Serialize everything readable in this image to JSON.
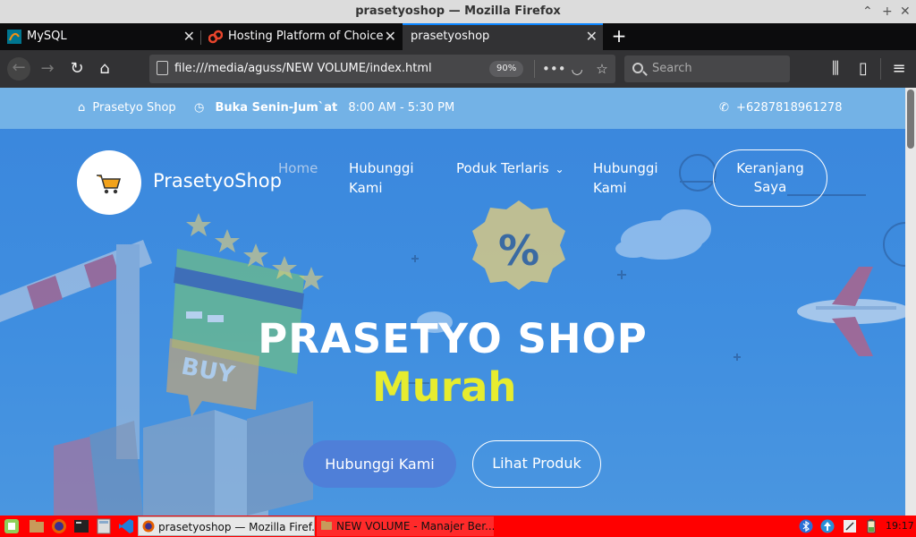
{
  "window": {
    "title": "prasetyoshop — Mozilla Firefox"
  },
  "tabs": [
    {
      "label": "MySQL",
      "icon": "mysql-icon"
    },
    {
      "label": "Hosting Platform of Choice",
      "icon": "hosting-icon"
    },
    {
      "label": "prasetyoshop",
      "icon": "none",
      "active": true
    }
  ],
  "toolbar": {
    "url": "file:///media/aguss/NEW VOLUME/index.html",
    "zoom": "90%",
    "search_placeholder": "Search"
  },
  "site": {
    "topbar": {
      "shop": "Prasetyo Shop",
      "hours_label": "Buka Senin-Jum`at",
      "hours": "8:00 AM - 5:30 PM",
      "phone": "+6287818961278"
    },
    "brand": "PrasetyoShop",
    "nav": {
      "home": "Home",
      "contact_1": "Hubunggi",
      "contact_2": "Kami",
      "products": "Poduk Terlaris",
      "contact2_1": "Hubunggi",
      "contact2_2": "Kami",
      "cart_1": "Keranjang",
      "cart_2": "Saya"
    },
    "hero": {
      "title": "PRASETYO SHOP",
      "subtitle": "Murah",
      "primary_button": "Hubunggi Kami",
      "secondary_button": "Lihat Produk"
    },
    "illustration": {
      "badge": "%",
      "sign": "BUY"
    }
  },
  "taskbar": {
    "tasks": [
      {
        "label": "prasetyoshop — Mozilla Firef...",
        "active": true
      },
      {
        "label": "NEW VOLUME - Manajer Ber...",
        "active": false
      }
    ],
    "clock": "19:17"
  },
  "colors": {
    "accent": "#0a84ff",
    "hero_yellow": "#e6ec2f",
    "taskbar": "#ff0000",
    "button_blue": "#4f7fd8"
  }
}
